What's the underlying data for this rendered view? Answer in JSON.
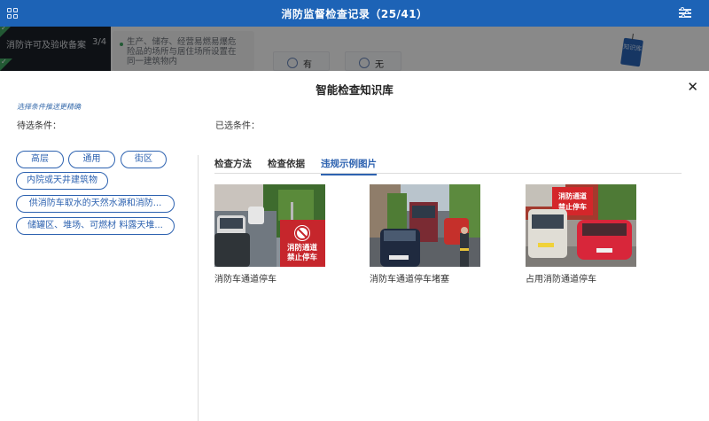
{
  "topbar": {
    "title": "消防监督检查记录（25/41）",
    "menu_icon": "grid-icon",
    "settings_icon": "settings-icon"
  },
  "background": {
    "left_item_label": "消防许可及验收备案",
    "left_item_count": "3/4",
    "question": "生产、储存、经营易燃易爆危险品的场所与居住场所设置在同一建筑物内",
    "option_yes": "有",
    "option_no": "无",
    "knowledge_badge": "知识库"
  },
  "modal": {
    "title": "智能检查知识库",
    "close_icon": "close-icon",
    "hint": "选择条件推送更精确",
    "pending_label": "待选条件：",
    "selected_label": "已选条件：",
    "tags": [
      "高层",
      "通用",
      "街区",
      "内院或天井建筑物",
      "供消防车取水的天然水源和消防...",
      "储罐区、堆场、可燃材 料露天堆..."
    ],
    "tabs": [
      "检查方法",
      "检查依据",
      "违规示例图片"
    ],
    "active_tab": "违规示例图片",
    "images": [
      {
        "caption": "消防车通道停车",
        "sign_text": "消防通道禁止停车"
      },
      {
        "caption": "消防车通道停车堵塞"
      },
      {
        "caption": "占用消防通道停车",
        "sign_text": "消防通道禁止停车"
      }
    ]
  },
  "colors": {
    "topbar": "#1d63b6",
    "accent": "#2d62b0",
    "check_green": "#3fa360"
  }
}
